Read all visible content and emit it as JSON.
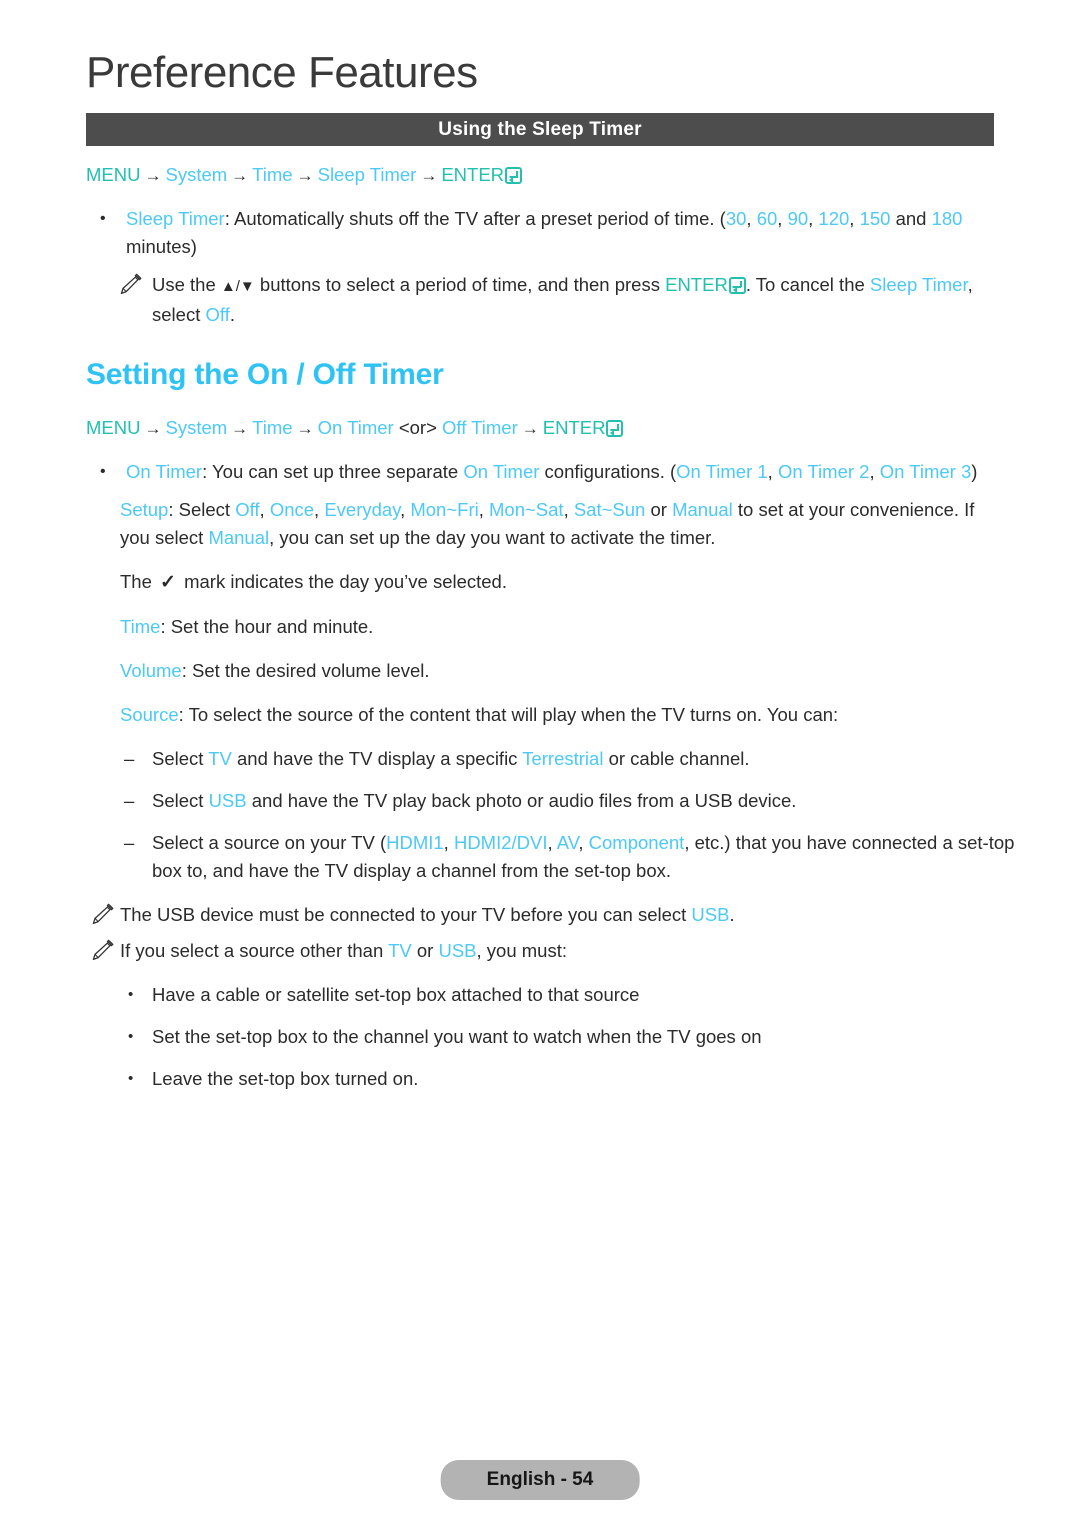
{
  "page": {
    "title": "Preference Features",
    "footer_label": "English - 54"
  },
  "section_bar": {
    "label": "Using the Sleep Timer"
  },
  "menu_path_1": {
    "menu": "MENU",
    "system": "System",
    "time": "Time",
    "sleep_timer": "Sleep Timer",
    "enter": "ENTER",
    "arrow": "→"
  },
  "sleep_timer_bullet": {
    "marker": "•",
    "term": "Sleep Timer",
    "text_1": ": Automatically shuts off the TV after a preset period of time. (",
    "values": [
      "30",
      "60",
      "90",
      "120",
      "150",
      "180"
    ],
    "sep": ", ",
    "and": " and ",
    "text_2": " minutes)"
  },
  "sleep_timer_note": {
    "icon": "pencil-note-icon",
    "text_1": "Use the ",
    "arrows": "▲/▼",
    "text_2": " buttons to select a period of time, and then press ",
    "enter": "ENTER",
    "text_3": ". To cancel the ",
    "term": "Sleep Timer",
    "text_4": ", select ",
    "off": "Off",
    "text_5": "."
  },
  "heading_on_off_timer": {
    "label": "Setting the On / Off Timer"
  },
  "menu_path_2": {
    "menu": "MENU",
    "system": "System",
    "time": "Time",
    "on_timer": "On Timer",
    "or": "<or>",
    "off_timer": "Off Timer",
    "enter": "ENTER",
    "arrow": "→"
  },
  "on_timer_bullet": {
    "marker": "•",
    "term": "On Timer",
    "text_1": ": You can set up three separate ",
    "term_2": "On Timer",
    "text_2": " configurations. (",
    "configs": [
      "On Timer 1",
      "On Timer 2",
      "On Timer 3"
    ],
    "sep": ", ",
    "text_3": ")"
  },
  "setup_para": {
    "term": "Setup",
    "text_1": ": Select ",
    "options": [
      "Off",
      "Once",
      "Everyday",
      "Mon~Fri",
      "Mon~Sat",
      "Sat~Sun"
    ],
    "sep": ", ",
    "or": " or ",
    "manual": "Manual",
    "text_2": " to set at your convenience. If you select ",
    "manual_2": "Manual",
    "text_3": ", you can set up the day you want to activate the timer."
  },
  "check_para": {
    "text_1": "The ",
    "check": "✓",
    "text_2": " mark indicates the day you’ve selected."
  },
  "time_para": {
    "term": "Time",
    "text": ": Set the hour and minute."
  },
  "volume_para": {
    "term": "Volume",
    "text": ": Set the desired volume level."
  },
  "source_para": {
    "term": "Source",
    "text": ": To select the source of the content that will play when the TV turns on. You can:"
  },
  "source_items": [
    {
      "marker": "–",
      "text_1": "Select ",
      "term": "TV",
      "text_2": " and have the TV display a specific ",
      "term_2": "Terrestrial",
      "text_3": " or cable channel."
    },
    {
      "marker": "–",
      "text_1": "Select ",
      "term": "USB",
      "text_2": " and have the TV play back photo or audio files from a USB device.",
      "term_2": "",
      "text_3": ""
    }
  ],
  "source_item_3": {
    "marker": "–",
    "text_1": "Select a source on your TV (",
    "sources": [
      "HDMI1",
      "HDMI2/DVI",
      "AV",
      "Component"
    ],
    "sep": ", ",
    "text_2": ", etc.) that you have connected a set-top box to, and have the TV display a channel from the set-top box."
  },
  "usb_note": {
    "icon": "pencil-note-icon",
    "text_1": "The USB device must be connected to your TV before you can select ",
    "term": "USB",
    "text_2": "."
  },
  "other_source_note": {
    "icon": "pencil-note-icon",
    "text_1": "If you select a source other than ",
    "term": "TV",
    "text_2": " or ",
    "term_2": "USB",
    "text_3": ", you must:"
  },
  "other_source_items": [
    {
      "marker": "•",
      "text": "Have a cable or satellite set-top box attached to that source"
    },
    {
      "marker": "•",
      "text": "Set the set-top box to the channel you want to watch when the TV goes on"
    },
    {
      "marker": "•",
      "text": "Leave the set-top box turned on."
    }
  ],
  "colors": {
    "cyan": "#4cc9f7",
    "teal": "#23c0b0",
    "heading": "#2ec2f5",
    "bar_bg": "#4d4d4d",
    "footer_bg": "#b3b3b3",
    "text": "#2b2b2b"
  }
}
